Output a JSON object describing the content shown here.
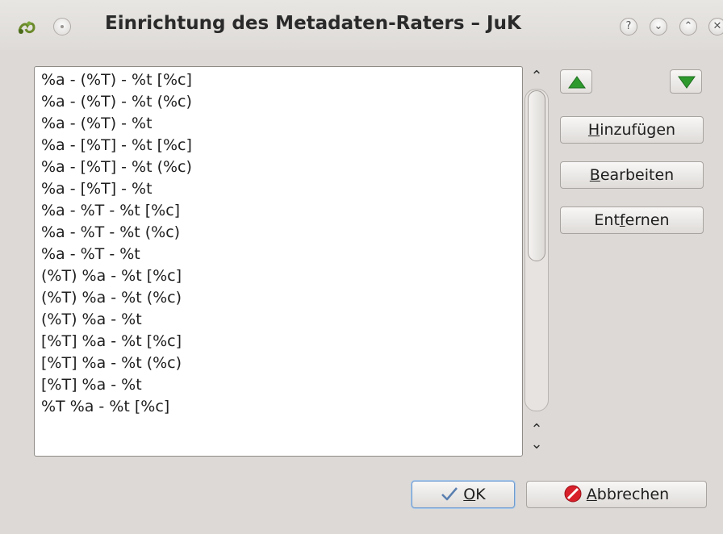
{
  "window": {
    "title": "Einrichtung des Metadaten-Raters – JuK",
    "help_label": "?",
    "min_label": "⌄",
    "max_label": "⌃",
    "close_label": "✕"
  },
  "list": {
    "items": [
      "%a - (%T) - %t [%c]",
      "%a - (%T) - %t (%c)",
      "%a - (%T) - %t",
      "%a - [%T] - %t [%c]",
      "%a - [%T] - %t (%c)",
      "%a - [%T] - %t",
      "%a - %T - %t [%c]",
      "%a - %T - %t (%c)",
      "%a - %T - %t",
      "(%T) %a - %t [%c]",
      "(%T) %a - %t (%c)",
      "(%T) %a - %t",
      "[%T] %a - %t [%c]",
      "[%T] %a - %t (%c)",
      "[%T] %a - %t",
      "%T %a - %t [%c]"
    ]
  },
  "scrollbar": {
    "up_glyph": "⌃",
    "up2_glyph": "⌃",
    "down_glyph": "⌄"
  },
  "side_buttons": {
    "add_label_pre": "",
    "add_label_ul": "H",
    "add_label_post": "inzufügen",
    "edit_label_pre": "",
    "edit_label_ul": "B",
    "edit_label_post": "earbeiten",
    "remove_label_pre": "Ent",
    "remove_label_ul": "f",
    "remove_label_post": "ernen"
  },
  "footer": {
    "ok_label_ul": "O",
    "ok_label_post": "K",
    "cancel_label_ul": "A",
    "cancel_label_post": "bbrechen"
  },
  "colors": {
    "accent_green": "#2e9a2e",
    "cancel_red": "#d8202a",
    "ok_blue": "#6f9bcf"
  }
}
